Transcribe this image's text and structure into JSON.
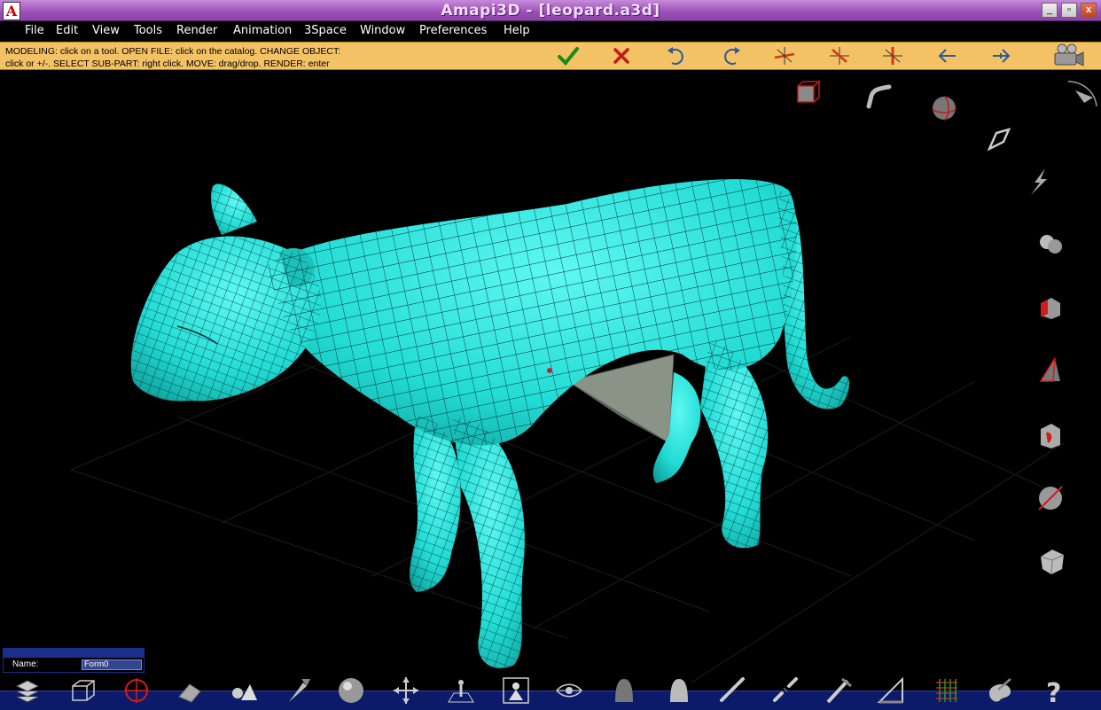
{
  "window": {
    "title": "Amapi3D - [leopard.a3d]",
    "logo": "A",
    "minimize": "_",
    "restore": "▫",
    "close": "x"
  },
  "menu": [
    "File",
    "Edit",
    "View",
    "Tools",
    "Render",
    "Animation",
    "3Space",
    "Window",
    "Preferences",
    "Help"
  ],
  "hint": {
    "line1": "MODELING: click on a tool. OPEN FILE: click on the catalog. CHANGE OBJECT:",
    "line2": "click or +/-. SELECT SUB-PART: right click. MOVE: drag/drop. RENDER: enter"
  },
  "toolbar_icons": [
    "confirm-checkmark",
    "cancel-x",
    "undo-arrow",
    "redo-arrow",
    "axis-x",
    "axis-y",
    "axis-z",
    "arrow-left",
    "arrow-right",
    "camera-render"
  ],
  "side_icons": [
    "cube-catalog",
    "bend-tool",
    "sphere-tool",
    "wire-tool",
    "lightning-tool",
    "blob-tool",
    "extrude-tool",
    "triangle-tool",
    "fillet-tool",
    "cut-sphere-tool",
    "polyhedron-tool"
  ],
  "bottom_icons": [
    "layers",
    "wire-cube",
    "target",
    "eraser",
    "terrain",
    "pointer-tool",
    "sphere",
    "move-cross",
    "grid-figure",
    "portrait-view",
    "eye-view",
    "ghost-dark",
    "ghost-light",
    "chain-link",
    "chain-broken",
    "measure-tool",
    "triangle-ruler",
    "color-grid",
    "palette",
    "help-question"
  ],
  "name_panel": {
    "label": "Name:",
    "value": "Form0"
  },
  "colors": {
    "title_bar": "#9a4fb6",
    "help_strip": "#f3c264",
    "model": "#2ee8e0",
    "bottom_bar": "#0c1b69"
  }
}
